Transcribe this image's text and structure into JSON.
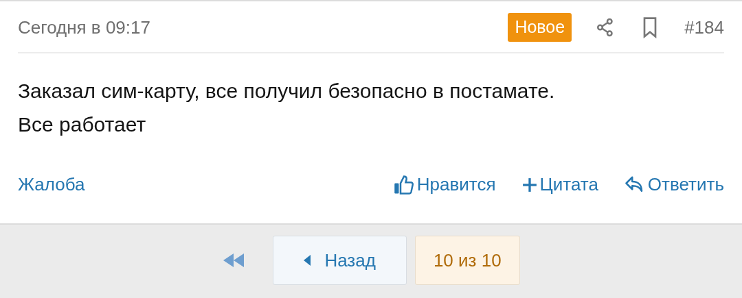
{
  "post": {
    "date": "Сегодня в 09:17",
    "badge": "Новое",
    "number": "#184",
    "text": [
      "Заказал сим-карту, все получил безопасно в постамате.",
      "Все работает"
    ],
    "actions": [
      {
        "kind": "report",
        "label": "Жалоба"
      },
      {
        "kind": "like",
        "label": "Нравится"
      },
      {
        "kind": "quote",
        "label": "Цитата"
      },
      {
        "kind": "reply",
        "label": "Ответить"
      }
    ]
  },
  "pager": {
    "prev": "Назад",
    "current": "10 из 10"
  }
}
